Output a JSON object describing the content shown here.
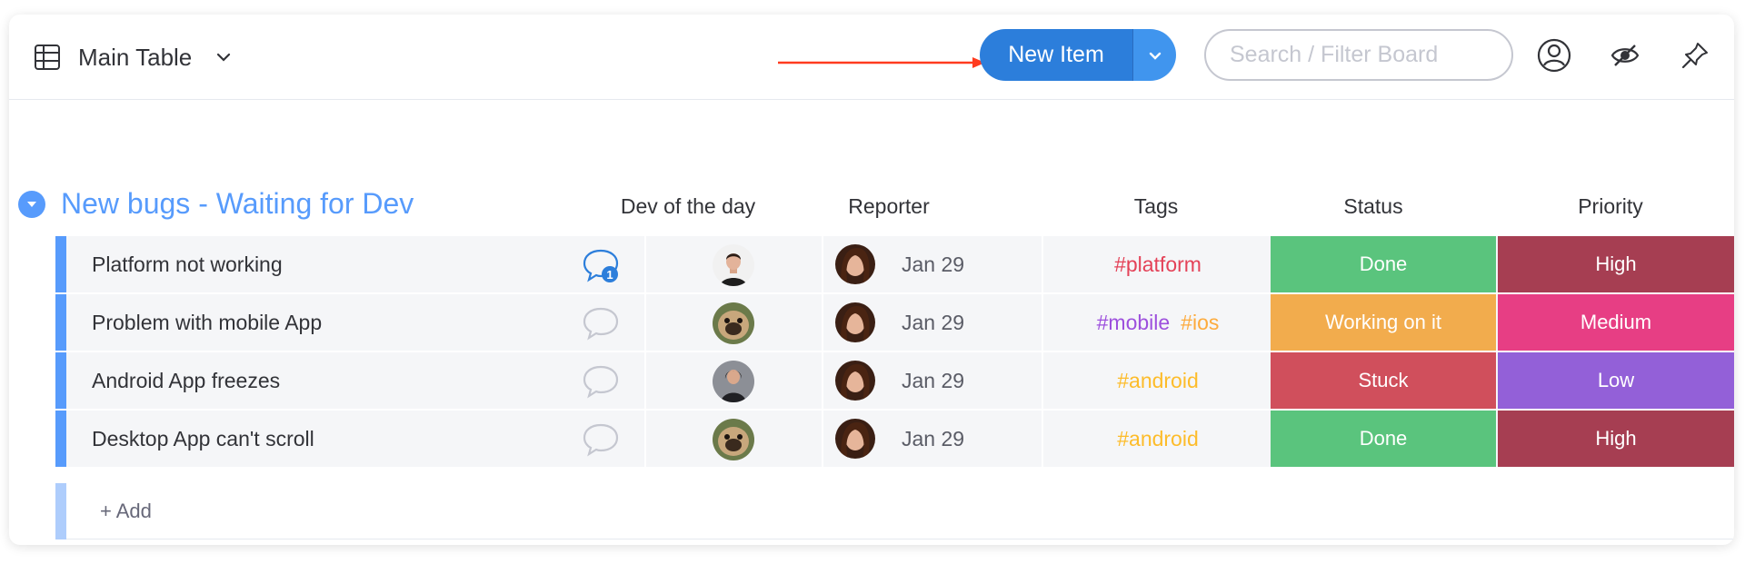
{
  "toolbar": {
    "view_name": "Main Table",
    "new_item_label": "New Item",
    "search_placeholder": "Search / Filter Board",
    "icons": [
      "table-icon",
      "chevron-down-icon",
      "user-icon",
      "eye-off-icon",
      "pin-icon"
    ]
  },
  "colors": {
    "accent": "#579bfc",
    "primary_button": "#2c7edb",
    "annotation_arrow": "#ff3b1f",
    "done": "#5ac47d",
    "working_on_it": "#f2ac4d",
    "stuck": "#d04f5c",
    "high": "#a63e52",
    "medium": "#e73e84",
    "low": "#9360d8",
    "tag_platform": "#e44258",
    "tag_mobile": "#9d50dd",
    "tag_ios": "#fdab3d",
    "tag_android": "#fdbc2a"
  },
  "group": {
    "title": "New bugs - Waiting for Dev",
    "columns": {
      "dev": "Dev of the day",
      "reporter": "Reporter",
      "tags": "Tags",
      "status": "Status",
      "priority": "Priority"
    },
    "rows": [
      {
        "name": "Platform not working",
        "updates": "1",
        "date": "Jan 29",
        "tag1": "#platform",
        "tag2": "",
        "status": "Done",
        "priority": "High"
      },
      {
        "name": "Problem with mobile App",
        "updates": "",
        "date": "Jan 29",
        "tag1": "#mobile",
        "tag2": "#ios",
        "status": "Working on it",
        "priority": "Medium"
      },
      {
        "name": "Android App freezes",
        "updates": "",
        "date": "Jan 29",
        "tag1": "#android",
        "tag2": "",
        "status": "Stuck",
        "priority": "Low"
      },
      {
        "name": "Desktop App can't scroll",
        "updates": "",
        "date": "Jan 29",
        "tag1": "#android",
        "tag2": "",
        "status": "Done",
        "priority": "High"
      }
    ],
    "add_label": "+ Add"
  }
}
